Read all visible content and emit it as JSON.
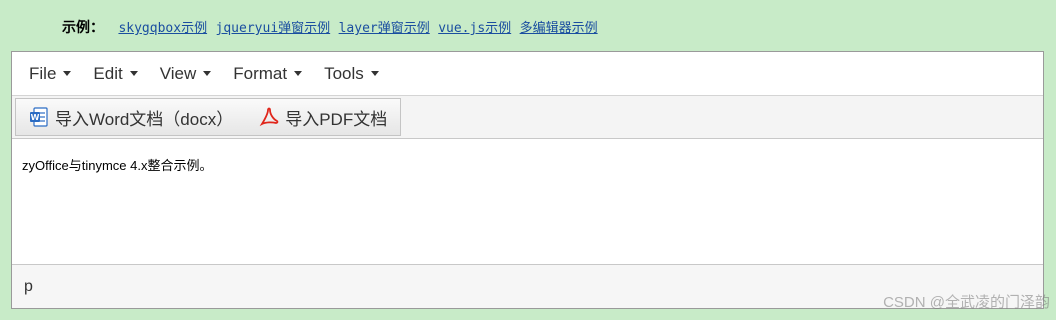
{
  "demo_links": {
    "label": "示例：",
    "items": [
      "skygqbox示例",
      "jqueryui弹窗示例",
      "layer弹窗示例",
      "vue.js示例",
      "多编辑器示例"
    ]
  },
  "menubar": {
    "items": [
      "File",
      "Edit",
      "View",
      "Format",
      "Tools"
    ]
  },
  "toolbar": {
    "import_word_label": "导入Word文档（docx）",
    "import_pdf_label": "导入PDF文档"
  },
  "editor": {
    "content_text": "zyOffice与tinymce 4.x整合示例。"
  },
  "statusbar": {
    "path": "p"
  },
  "watermark": "CSDN @全武凌的门泽韵"
}
